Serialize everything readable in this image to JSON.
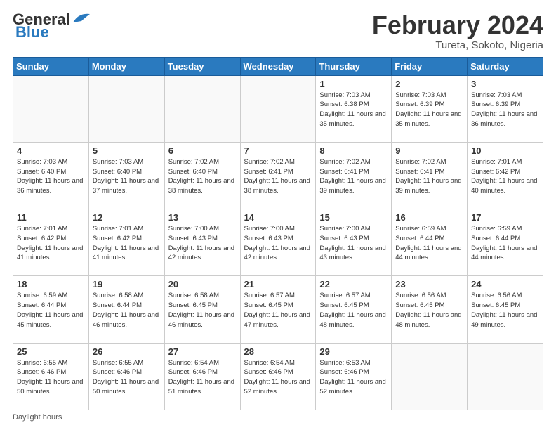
{
  "logo": {
    "line1": "General",
    "line2": "Blue"
  },
  "title": "February 2024",
  "location": "Tureta, Sokoto, Nigeria",
  "weekdays": [
    "Sunday",
    "Monday",
    "Tuesday",
    "Wednesday",
    "Thursday",
    "Friday",
    "Saturday"
  ],
  "weeks": [
    [
      {
        "day": "",
        "sunrise": "",
        "sunset": "",
        "daylight": ""
      },
      {
        "day": "",
        "sunrise": "",
        "sunset": "",
        "daylight": ""
      },
      {
        "day": "",
        "sunrise": "",
        "sunset": "",
        "daylight": ""
      },
      {
        "day": "",
        "sunrise": "",
        "sunset": "",
        "daylight": ""
      },
      {
        "day": "1",
        "sunrise": "Sunrise: 7:03 AM",
        "sunset": "Sunset: 6:38 PM",
        "daylight": "Daylight: 11 hours and 35 minutes."
      },
      {
        "day": "2",
        "sunrise": "Sunrise: 7:03 AM",
        "sunset": "Sunset: 6:39 PM",
        "daylight": "Daylight: 11 hours and 35 minutes."
      },
      {
        "day": "3",
        "sunrise": "Sunrise: 7:03 AM",
        "sunset": "Sunset: 6:39 PM",
        "daylight": "Daylight: 11 hours and 36 minutes."
      }
    ],
    [
      {
        "day": "4",
        "sunrise": "Sunrise: 7:03 AM",
        "sunset": "Sunset: 6:40 PM",
        "daylight": "Daylight: 11 hours and 36 minutes."
      },
      {
        "day": "5",
        "sunrise": "Sunrise: 7:03 AM",
        "sunset": "Sunset: 6:40 PM",
        "daylight": "Daylight: 11 hours and 37 minutes."
      },
      {
        "day": "6",
        "sunrise": "Sunrise: 7:02 AM",
        "sunset": "Sunset: 6:40 PM",
        "daylight": "Daylight: 11 hours and 38 minutes."
      },
      {
        "day": "7",
        "sunrise": "Sunrise: 7:02 AM",
        "sunset": "Sunset: 6:41 PM",
        "daylight": "Daylight: 11 hours and 38 minutes."
      },
      {
        "day": "8",
        "sunrise": "Sunrise: 7:02 AM",
        "sunset": "Sunset: 6:41 PM",
        "daylight": "Daylight: 11 hours and 39 minutes."
      },
      {
        "day": "9",
        "sunrise": "Sunrise: 7:02 AM",
        "sunset": "Sunset: 6:41 PM",
        "daylight": "Daylight: 11 hours and 39 minutes."
      },
      {
        "day": "10",
        "sunrise": "Sunrise: 7:01 AM",
        "sunset": "Sunset: 6:42 PM",
        "daylight": "Daylight: 11 hours and 40 minutes."
      }
    ],
    [
      {
        "day": "11",
        "sunrise": "Sunrise: 7:01 AM",
        "sunset": "Sunset: 6:42 PM",
        "daylight": "Daylight: 11 hours and 41 minutes."
      },
      {
        "day": "12",
        "sunrise": "Sunrise: 7:01 AM",
        "sunset": "Sunset: 6:42 PM",
        "daylight": "Daylight: 11 hours and 41 minutes."
      },
      {
        "day": "13",
        "sunrise": "Sunrise: 7:00 AM",
        "sunset": "Sunset: 6:43 PM",
        "daylight": "Daylight: 11 hours and 42 minutes."
      },
      {
        "day": "14",
        "sunrise": "Sunrise: 7:00 AM",
        "sunset": "Sunset: 6:43 PM",
        "daylight": "Daylight: 11 hours and 42 minutes."
      },
      {
        "day": "15",
        "sunrise": "Sunrise: 7:00 AM",
        "sunset": "Sunset: 6:43 PM",
        "daylight": "Daylight: 11 hours and 43 minutes."
      },
      {
        "day": "16",
        "sunrise": "Sunrise: 6:59 AM",
        "sunset": "Sunset: 6:44 PM",
        "daylight": "Daylight: 11 hours and 44 minutes."
      },
      {
        "day": "17",
        "sunrise": "Sunrise: 6:59 AM",
        "sunset": "Sunset: 6:44 PM",
        "daylight": "Daylight: 11 hours and 44 minutes."
      }
    ],
    [
      {
        "day": "18",
        "sunrise": "Sunrise: 6:59 AM",
        "sunset": "Sunset: 6:44 PM",
        "daylight": "Daylight: 11 hours and 45 minutes."
      },
      {
        "day": "19",
        "sunrise": "Sunrise: 6:58 AM",
        "sunset": "Sunset: 6:44 PM",
        "daylight": "Daylight: 11 hours and 46 minutes."
      },
      {
        "day": "20",
        "sunrise": "Sunrise: 6:58 AM",
        "sunset": "Sunset: 6:45 PM",
        "daylight": "Daylight: 11 hours and 46 minutes."
      },
      {
        "day": "21",
        "sunrise": "Sunrise: 6:57 AM",
        "sunset": "Sunset: 6:45 PM",
        "daylight": "Daylight: 11 hours and 47 minutes."
      },
      {
        "day": "22",
        "sunrise": "Sunrise: 6:57 AM",
        "sunset": "Sunset: 6:45 PM",
        "daylight": "Daylight: 11 hours and 48 minutes."
      },
      {
        "day": "23",
        "sunrise": "Sunrise: 6:56 AM",
        "sunset": "Sunset: 6:45 PM",
        "daylight": "Daylight: 11 hours and 48 minutes."
      },
      {
        "day": "24",
        "sunrise": "Sunrise: 6:56 AM",
        "sunset": "Sunset: 6:45 PM",
        "daylight": "Daylight: 11 hours and 49 minutes."
      }
    ],
    [
      {
        "day": "25",
        "sunrise": "Sunrise: 6:55 AM",
        "sunset": "Sunset: 6:46 PM",
        "daylight": "Daylight: 11 hours and 50 minutes."
      },
      {
        "day": "26",
        "sunrise": "Sunrise: 6:55 AM",
        "sunset": "Sunset: 6:46 PM",
        "daylight": "Daylight: 11 hours and 50 minutes."
      },
      {
        "day": "27",
        "sunrise": "Sunrise: 6:54 AM",
        "sunset": "Sunset: 6:46 PM",
        "daylight": "Daylight: 11 hours and 51 minutes."
      },
      {
        "day": "28",
        "sunrise": "Sunrise: 6:54 AM",
        "sunset": "Sunset: 6:46 PM",
        "daylight": "Daylight: 11 hours and 52 minutes."
      },
      {
        "day": "29",
        "sunrise": "Sunrise: 6:53 AM",
        "sunset": "Sunset: 6:46 PM",
        "daylight": "Daylight: 11 hours and 52 minutes."
      },
      {
        "day": "",
        "sunrise": "",
        "sunset": "",
        "daylight": ""
      },
      {
        "day": "",
        "sunrise": "",
        "sunset": "",
        "daylight": ""
      }
    ]
  ],
  "footer": {
    "daylight_label": "Daylight hours"
  }
}
